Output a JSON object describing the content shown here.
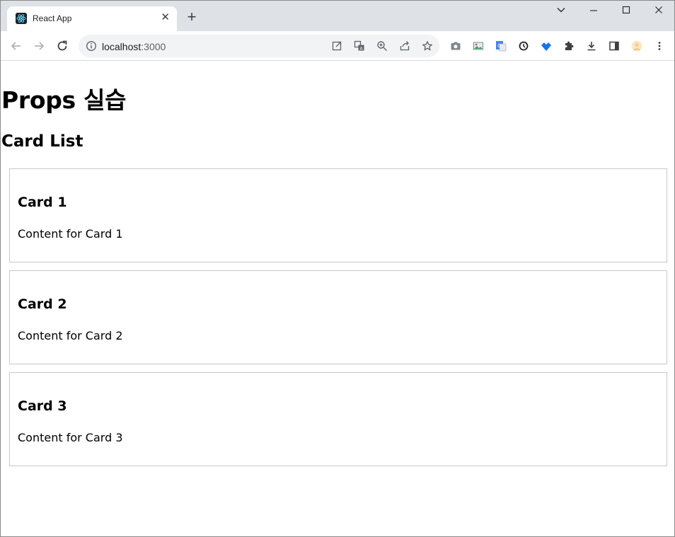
{
  "browser": {
    "tab": {
      "title": "React App",
      "close_symbol": "✕"
    },
    "new_tab_symbol": "+",
    "window_controls": {
      "tabsearch": "⌄",
      "minimize": "—",
      "maximize": "☐",
      "close": "✕"
    },
    "address_bar": {
      "host": "localhost",
      "port": ":3000"
    },
    "icons": {
      "back": "arrow-left-icon",
      "forward": "arrow-right-icon",
      "reload": "reload-icon",
      "info": "info-icon",
      "omnibox": [
        "open-in-app-icon",
        "translate-icon",
        "zoom-icon",
        "share-icon",
        "star-icon"
      ],
      "extensions": [
        "camera-icon",
        "image-icon",
        "google-translate-icon",
        "sync-icon",
        "download-arrow-icon",
        "puzzle-icon",
        "download-icon",
        "sidepanel-icon",
        "profile-icon",
        "menu-icon"
      ]
    },
    "colors": {
      "tabstrip": "#dee1e6",
      "omnibox": "#f1f3f4",
      "accent": "#1a73e8"
    }
  },
  "page": {
    "title": "Props 실습",
    "section_title": "Card List",
    "cards": [
      {
        "title": "Card 1",
        "content": "Content for Card 1"
      },
      {
        "title": "Card 2",
        "content": "Content for Card 2"
      },
      {
        "title": "Card 3",
        "content": "Content for Card 3"
      }
    ]
  }
}
